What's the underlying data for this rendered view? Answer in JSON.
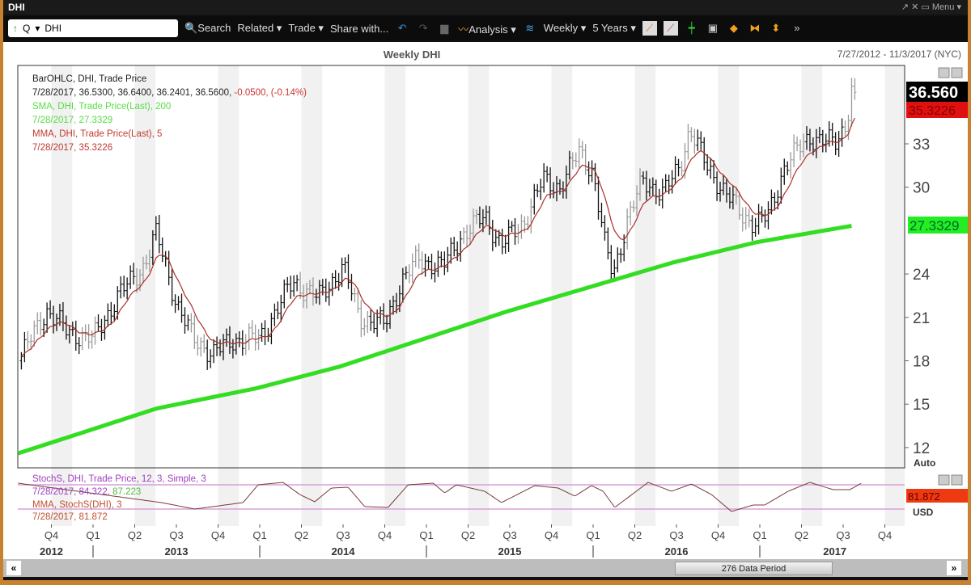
{
  "window": {
    "title": "DHI",
    "menu": "Menu"
  },
  "toolbar": {
    "symbol_prefix": "Q",
    "symbol": "DHI",
    "search": "Search",
    "related": "Related ▾",
    "trade": "Trade ▾",
    "share": "Share with...",
    "analysis": "Analysis ▾",
    "interval": "Weekly ▾",
    "range": "5 Years ▾"
  },
  "header": {
    "title": "Weekly DHI",
    "date_range": "7/27/2012 - 11/3/2017 (NYC)"
  },
  "legend": {
    "bar_label": "BarOHLC, DHI, Trade Price",
    "bar_values": "7/28/2017, 36.5300, 36.6400, 36.2401, 36.5600,",
    "bar_change": "-0.0500, (-0.14%)",
    "sma_label": "SMA, DHI, Trade Price(Last),  200",
    "sma_value": "7/28/2017, 27.3329",
    "mma_label": "MMA, DHI, Trade Price(Last),  5",
    "mma_value": "7/28/2017, 35.3226",
    "stoch_label": "StochS, DHI, Trade Price,  12, 3, Simple, 3",
    "stoch_value": "7/28/2017, 84.322,",
    "stoch_value2": "87.223",
    "stoch_mma_label": "MMA, StochS(DHI),  3",
    "stoch_mma_value": "7/28/2017, 81.872"
  },
  "badges": {
    "last": "36.560",
    "mma": "35.3226",
    "sma": "27.3329",
    "stoch": "81.872",
    "auto": "Auto",
    "currency": "USD"
  },
  "colors": {
    "sma": "#33dd22",
    "mma": "#a8302a",
    "bar": "#111111",
    "bar_alt": "#9a9a9a",
    "stoch": "#7a3a3a",
    "band": "#d9a0d9"
  },
  "footer": {
    "period": "276 Data Period"
  },
  "chart_data": {
    "type": "ohlc",
    "title": "Weekly DHI",
    "ylim": [
      11,
      37.5
    ],
    "yticks": [
      12,
      15,
      18,
      21,
      24,
      30,
      33
    ],
    "xlim": [
      2012.57,
      2017.84
    ],
    "quarters": [
      {
        "t": 2012.75,
        "l": "Q4"
      },
      {
        "t": 2013,
        "l": "Q1"
      },
      {
        "t": 2013.25,
        "l": "Q2"
      },
      {
        "t": 2013.5,
        "l": "Q3"
      },
      {
        "t": 2013.75,
        "l": "Q4"
      },
      {
        "t": 2014,
        "l": "Q1"
      },
      {
        "t": 2014.25,
        "l": "Q2"
      },
      {
        "t": 2014.5,
        "l": "Q3"
      },
      {
        "t": 2014.75,
        "l": "Q4"
      },
      {
        "t": 2015,
        "l": "Q1"
      },
      {
        "t": 2015.25,
        "l": "Q2"
      },
      {
        "t": 2015.5,
        "l": "Q3"
      },
      {
        "t": 2015.75,
        "l": "Q4"
      },
      {
        "t": 2016,
        "l": "Q1"
      },
      {
        "t": 2016.25,
        "l": "Q2"
      },
      {
        "t": 2016.5,
        "l": "Q3"
      },
      {
        "t": 2016.75,
        "l": "Q4"
      },
      {
        "t": 2017,
        "l": "Q1"
      },
      {
        "t": 2017.25,
        "l": "Q2"
      },
      {
        "t": 2017.5,
        "l": "Q3"
      },
      {
        "t": 2017.75,
        "l": "Q4"
      }
    ],
    "years": [
      {
        "t": 2012.75,
        "l": "2012"
      },
      {
        "t": 2013.5,
        "l": "2013"
      },
      {
        "t": 2014.5,
        "l": "2014"
      },
      {
        "t": 2015.5,
        "l": "2015"
      },
      {
        "t": 2016.5,
        "l": "2016"
      },
      {
        "t": 2017.45,
        "l": "2017"
      }
    ],
    "close_anchors": [
      [
        2012.57,
        18.3
      ],
      [
        2012.72,
        21.5
      ],
      [
        2012.85,
        20
      ],
      [
        2013.0,
        19.5
      ],
      [
        2013.15,
        22.5
      ],
      [
        2013.3,
        24.5
      ],
      [
        2013.38,
        26.8
      ],
      [
        2013.5,
        22
      ],
      [
        2013.6,
        19.5
      ],
      [
        2013.72,
        18.5
      ],
      [
        2013.85,
        19.5
      ],
      [
        2014.0,
        19.5
      ],
      [
        2014.1,
        21.5
      ],
      [
        2014.2,
        23.5
      ],
      [
        2014.35,
        22.3
      ],
      [
        2014.5,
        24.5
      ],
      [
        2014.6,
        21
      ],
      [
        2014.75,
        20.5
      ],
      [
        2014.85,
        23.5
      ],
      [
        2014.95,
        25
      ],
      [
        2015.1,
        24.5
      ],
      [
        2015.2,
        26.5
      ],
      [
        2015.35,
        28
      ],
      [
        2015.45,
        26
      ],
      [
        2015.58,
        27.5
      ],
      [
        2015.7,
        30.5
      ],
      [
        2015.8,
        30
      ],
      [
        2015.92,
        32.5
      ],
      [
        2016.0,
        31
      ],
      [
        2016.07,
        26
      ],
      [
        2016.12,
        24
      ],
      [
        2016.2,
        27.5
      ],
      [
        2016.3,
        30.5
      ],
      [
        2016.42,
        29.5
      ],
      [
        2016.52,
        31.5
      ],
      [
        2016.58,
        34
      ],
      [
        2016.68,
        31.5
      ],
      [
        2016.8,
        29.5
      ],
      [
        2016.9,
        28
      ],
      [
        2016.98,
        27.5
      ],
      [
        2017.05,
        28
      ],
      [
        2017.15,
        31.5
      ],
      [
        2017.3,
        33.5
      ],
      [
        2017.45,
        33
      ],
      [
        2017.52,
        34.5
      ],
      [
        2017.55,
        36.8
      ],
      [
        2017.57,
        36.56
      ]
    ],
    "sma200_anchors": [
      [
        2012.57,
        11.6
      ],
      [
        2013.0,
        13.2
      ],
      [
        2013.4,
        14.7
      ],
      [
        2014.0,
        16.1
      ],
      [
        2014.5,
        17.6
      ],
      [
        2015.0,
        19.5
      ],
      [
        2015.5,
        21.4
      ],
      [
        2016.0,
        23.1
      ],
      [
        2016.5,
        24.8
      ],
      [
        2017.0,
        26.2
      ],
      [
        2017.57,
        27.33
      ]
    ],
    "stoch": {
      "ylim": [
        0,
        100
      ],
      "bands": [
        80,
        20
      ],
      "anchors": [
        [
          2012.55,
          84
        ],
        [
          2013.41,
          36
        ],
        [
          2013.61,
          20
        ],
        [
          2013.9,
          36
        ],
        [
          2013.99,
          80
        ],
        [
          2014.14,
          86
        ],
        [
          2014.24,
          56
        ],
        [
          2014.33,
          38
        ],
        [
          2014.43,
          72
        ],
        [
          2014.53,
          74
        ],
        [
          2014.63,
          26
        ],
        [
          2014.77,
          24
        ],
        [
          2014.89,
          80
        ],
        [
          2015.04,
          84
        ],
        [
          2015.11,
          60
        ],
        [
          2015.18,
          80
        ],
        [
          2015.35,
          64
        ],
        [
          2015.45,
          36
        ],
        [
          2015.65,
          78
        ],
        [
          2015.79,
          72
        ],
        [
          2015.89,
          52
        ],
        [
          2015.99,
          78
        ],
        [
          2016.06,
          64
        ],
        [
          2016.13,
          24
        ],
        [
          2016.33,
          86
        ],
        [
          2016.47,
          64
        ],
        [
          2016.59,
          82
        ],
        [
          2016.71,
          56
        ],
        [
          2016.83,
          14
        ],
        [
          2016.96,
          30
        ],
        [
          2017.03,
          30
        ],
        [
          2017.17,
          64
        ],
        [
          2017.3,
          86
        ],
        [
          2017.44,
          68
        ],
        [
          2017.54,
          68
        ],
        [
          2017.61,
          84
        ]
      ]
    }
  }
}
